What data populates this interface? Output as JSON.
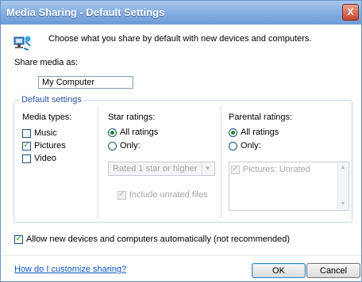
{
  "window": {
    "title": "Media Sharing - Default Settings",
    "close_label": "X"
  },
  "header": {
    "text": "Choose what you share by default with new devices and computers."
  },
  "share_media": {
    "label": "Share media as:",
    "value": "My Computer"
  },
  "default_settings": {
    "legend": "Default settings",
    "media_types": {
      "title": "Media types:",
      "items": [
        {
          "label": "Music",
          "checked": false
        },
        {
          "label": "Pictures",
          "checked": true
        },
        {
          "label": "Video",
          "checked": false
        }
      ]
    },
    "star_ratings": {
      "title": "Star ratings:",
      "all_label": "All ratings",
      "only_label": "Only:",
      "selected": "all",
      "dropdown_value": "Rated 1 star or higher",
      "include_unrated_label": "Include unrated files",
      "include_unrated_checked": true
    },
    "parental_ratings": {
      "title": "Parental ratings:",
      "all_label": "All ratings",
      "only_label": "Only:",
      "selected": "all",
      "list_items": [
        {
          "label": "Pictures: Unrated",
          "checked": true
        }
      ]
    }
  },
  "allow_devices": {
    "label": "Allow new devices and computers automatically (not recommended)",
    "checked": true
  },
  "footer": {
    "help_link": "How do I customize sharing?",
    "ok_label": "OK",
    "cancel_label": "Cancel"
  },
  "colors": {
    "title_bar": "#82ace0",
    "link": "#0b55c5",
    "legend": "#2b55a4",
    "close": "#c9452c"
  }
}
